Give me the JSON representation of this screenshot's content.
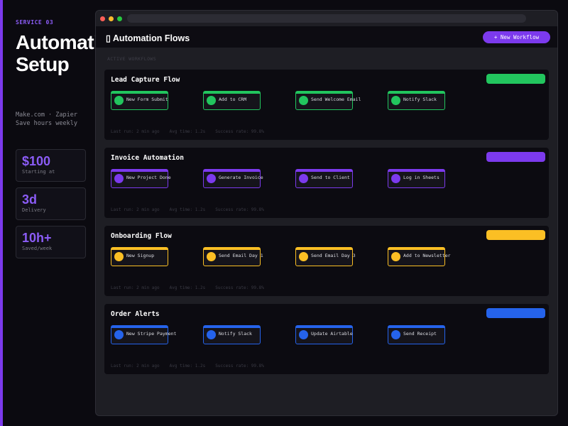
{
  "sidebar": {
    "eyebrow": "SERVICE 03",
    "hero_line1": "Automation",
    "hero_line2": "Setup",
    "tagline_line1": "Make.com · Zapier",
    "tagline_line2": "Save hours weekly",
    "stats": [
      {
        "value": "$100",
        "label": "Starting at"
      },
      {
        "value": "3d",
        "label": "Delivery"
      },
      {
        "value": "10h+",
        "label": "Saved/week"
      }
    ],
    "accent_color": "#7c3aed"
  },
  "window": {
    "title": "Automation Flows",
    "title_icon": "flow-icon",
    "new_button_label": "+ New Workflow",
    "section_label": "ACTIVE WORKFLOWS",
    "controls": {
      "close_color": "#ff5f57",
      "minimize_color": "#febc2e",
      "maximize_color": "#28c840"
    }
  },
  "flows": [
    {
      "name": "Lead Capture Flow",
      "color": "#22c55e",
      "steps": [
        "New Form Submit",
        "Add to CRM",
        "Send Welcome Email",
        "Notify Slack"
      ],
      "metrics": {
        "last_run": "Last run: 2 min ago",
        "avg_time": "Avg time: 1.2s",
        "success": "Success rate: 99.8%"
      }
    },
    {
      "name": "Invoice Automation",
      "color": "#7c3aed",
      "steps": [
        "New Project Done",
        "Generate Invoice",
        "Send to Client",
        "Log in Sheets"
      ],
      "metrics": {
        "last_run": "Last run: 2 min ago",
        "avg_time": "Avg time: 1.2s",
        "success": "Success rate: 99.8%"
      }
    },
    {
      "name": "Onboarding Flow",
      "color": "#fbbf24",
      "steps": [
        "New Signup",
        "Send Email Day 1",
        "Send Email Day 3",
        "Add to Newsletter"
      ],
      "metrics": {
        "last_run": "Last run: 2 min ago",
        "avg_time": "Avg time: 1.2s",
        "success": "Success rate: 99.8%"
      }
    },
    {
      "name": "Order Alerts",
      "color": "#2563eb",
      "steps": [
        "New Stripe Payment",
        "Notify Slack",
        "Update Airtable",
        "Send Receipt"
      ],
      "metrics": {
        "last_run": "Last run: 2 min ago",
        "avg_time": "Avg time: 1.2s",
        "success": "Success rate: 99.8%"
      }
    }
  ]
}
